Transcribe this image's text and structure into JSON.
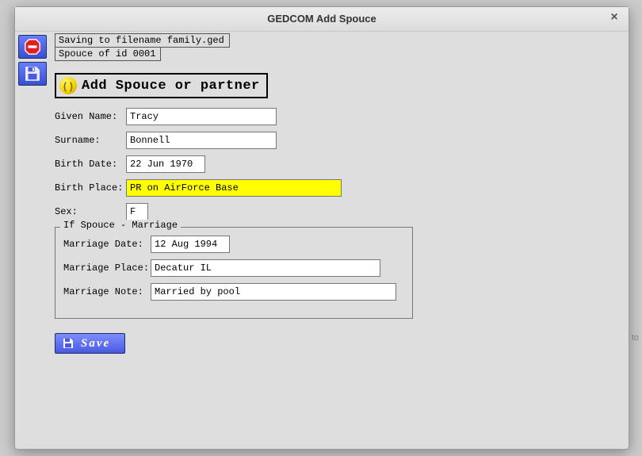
{
  "window": {
    "title": "GEDCOM Add Spouce"
  },
  "status": {
    "line1": "Saving to filename family.ged",
    "line2": "Spouce of id 0001"
  },
  "section_header": "Add Spouce or partner",
  "labels": {
    "given_name": "Given Name:",
    "surname": "Surname:",
    "birth_date": "Birth Date:",
    "birth_place": "Birth Place:",
    "sex": "Sex:",
    "legend": "If Spouce - Marriage",
    "marriage_date": "Marriage Date:",
    "marriage_place": "Marriage Place:",
    "marriage_note": "Marriage Note:"
  },
  "values": {
    "given_name": "Tracy",
    "surname": "Bonnell",
    "birth_date": "22 Jun 1970",
    "birth_place": "PR on AirForce Base",
    "sex": "F",
    "marriage_date": "12 Aug 1994",
    "marriage_place": "Decatur IL",
    "marriage_note": "Married by pool"
  },
  "buttons": {
    "save": "Save"
  },
  "bg": {
    "frag1": "ke it's supposed to"
  }
}
